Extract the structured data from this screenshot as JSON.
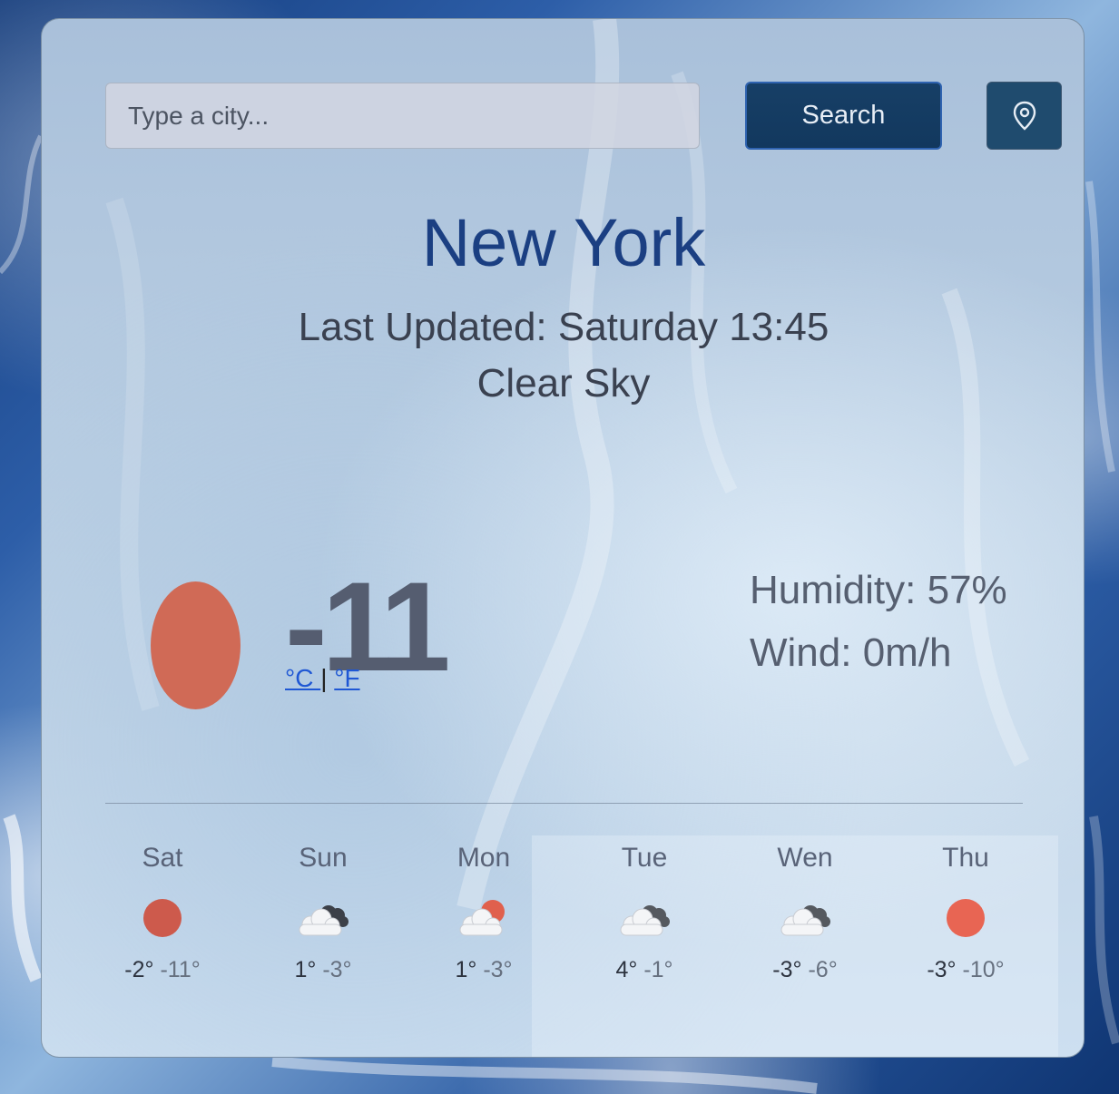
{
  "search": {
    "placeholder": "Type a city...",
    "button_label": "Search",
    "location_icon": "location-pin-icon"
  },
  "current": {
    "city": "New York",
    "last_updated": "Last Updated: Saturday 13:45",
    "description": "Clear Sky",
    "icon": "sun-icon",
    "icon_color": "#d06a56",
    "temperature": "-11",
    "unit_celsius": "°C ",
    "unit_separator": "|",
    "unit_fahrenheit": "°F",
    "humidity": "Humidity: 57%",
    "wind": "Wind: 0m/h"
  },
  "forecast": [
    {
      "day": "Sat",
      "icon": "sun-icon",
      "max": "-2°",
      "min": "-11°"
    },
    {
      "day": "Sun",
      "icon": "cloud-icon",
      "max": "1°",
      "min": "-3°"
    },
    {
      "day": "Mon",
      "icon": "partly-cloudy-icon",
      "max": "1°",
      "min": "-3°"
    },
    {
      "day": "Tue",
      "icon": "cloud-icon",
      "max": "4°",
      "min": "-1°"
    },
    {
      "day": "Wen",
      "icon": "cloud-icon",
      "max": "-3°",
      "min": "-6°"
    },
    {
      "day": "Thu",
      "icon": "sun-icon",
      "max": "-3°",
      "min": "-10°"
    }
  ],
  "colors": {
    "accent_button": "#12385e",
    "city_title": "#1b3f82",
    "sun": "#cd5a4c",
    "link": "#1f57d4"
  }
}
